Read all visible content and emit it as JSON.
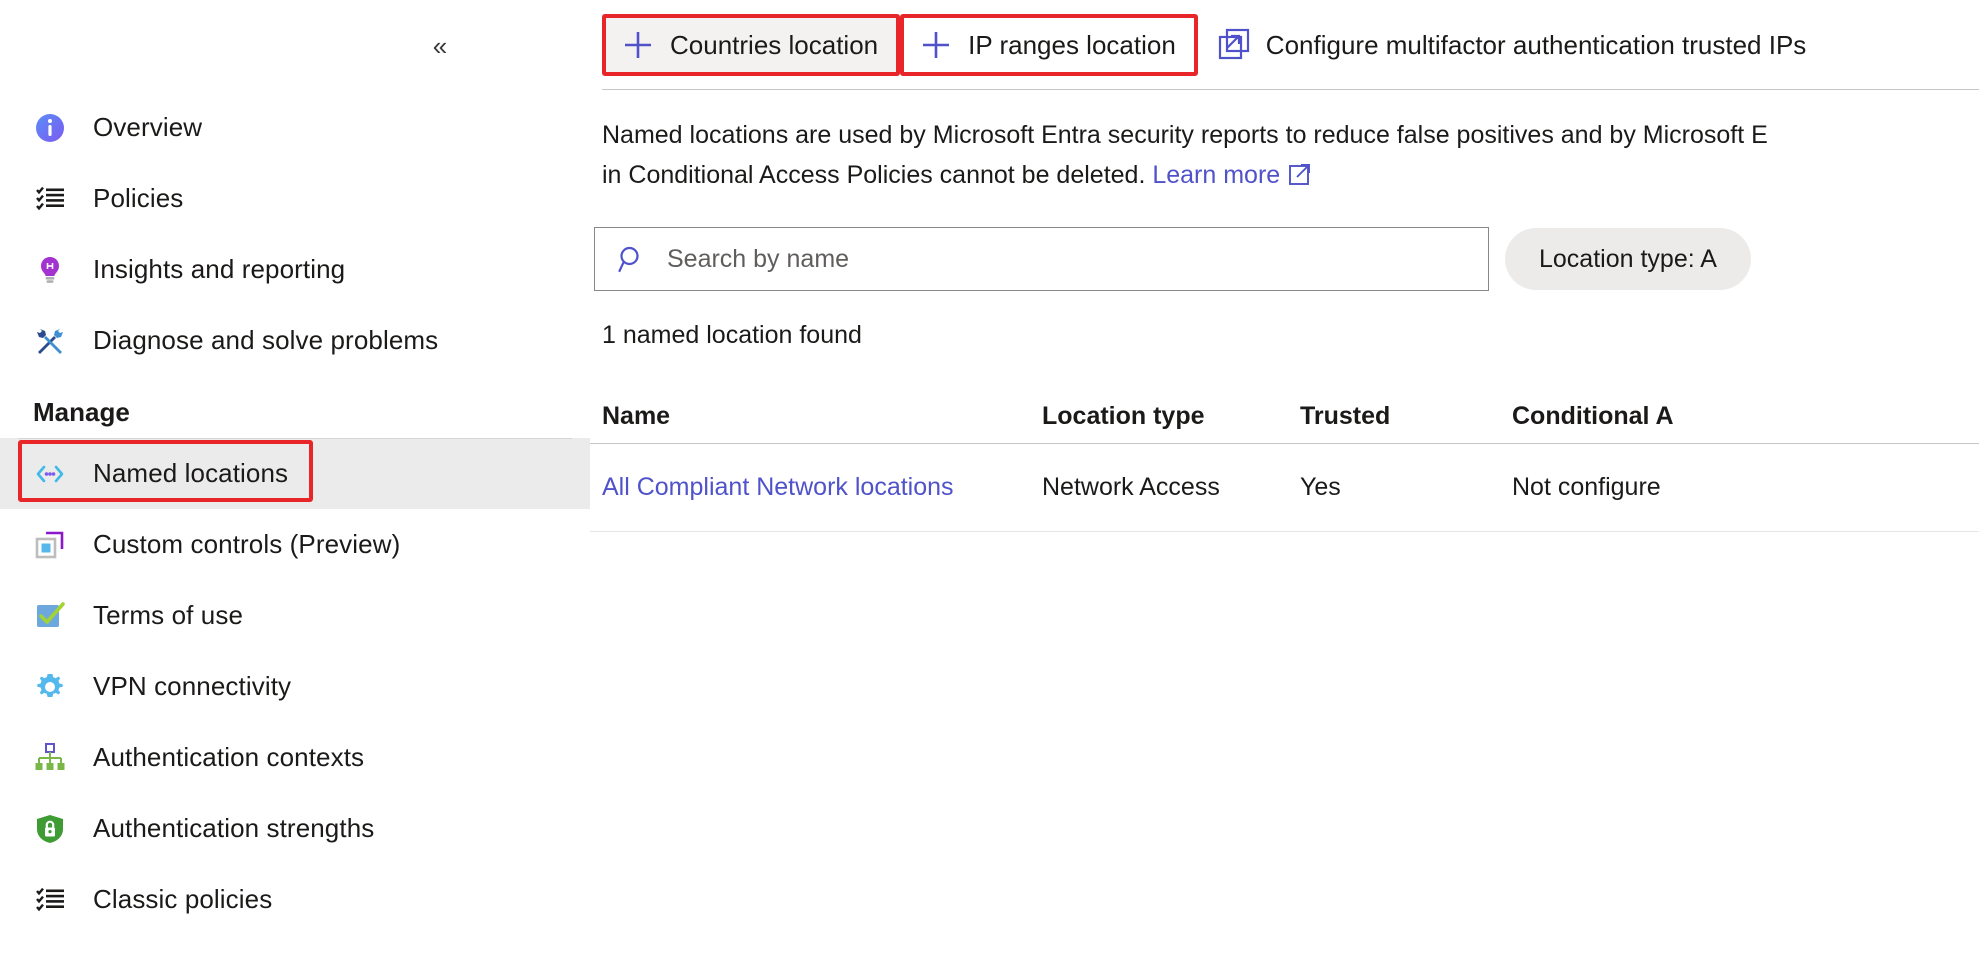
{
  "sidebar": {
    "collapse_glyph": "«",
    "collapse_label": "Collapse navigation",
    "items": [
      {
        "label": "Overview",
        "icon": "info-icon"
      },
      {
        "label": "Policies",
        "icon": "checklist-icon"
      },
      {
        "label": "Insights and reporting",
        "icon": "lightbulb-icon"
      },
      {
        "label": "Diagnose and solve problems",
        "icon": "tools-icon"
      }
    ],
    "group_label": "Manage",
    "manage_items": [
      {
        "label": "Named locations",
        "icon": "location-range-icon",
        "selected": true
      },
      {
        "label": "Custom controls (Preview)",
        "icon": "custom-controls-icon",
        "selected": false
      },
      {
        "label": "Terms of use",
        "icon": "checkbox-check-icon",
        "selected": false
      },
      {
        "label": "VPN connectivity",
        "icon": "gear-icon",
        "selected": false
      },
      {
        "label": "Authentication contexts",
        "icon": "hierarchy-icon",
        "selected": false
      },
      {
        "label": "Authentication strengths",
        "icon": "shield-lock-icon",
        "selected": false
      },
      {
        "label": "Classic policies",
        "icon": "checklist-icon",
        "selected": false
      }
    ]
  },
  "commandbar": {
    "buttons": [
      {
        "label": "Countries location",
        "icon": "plus-icon",
        "highlighted": true,
        "hovered": true
      },
      {
        "label": "IP ranges location",
        "icon": "plus-icon",
        "highlighted": true,
        "hovered": false
      },
      {
        "label": "Configure multifactor authentication trusted IPs",
        "icon": "external-link-icon",
        "highlighted": false,
        "hovered": false
      }
    ]
  },
  "description": {
    "line1": "Named locations are used by Microsoft Entra security reports to reduce false positives and by Microsoft E",
    "line2_prefix": "in Conditional Access Policies cannot be deleted. ",
    "learn_more": "Learn more"
  },
  "search": {
    "placeholder": "Search by name",
    "value": "",
    "icon": "search-icon"
  },
  "filter": {
    "pill_label": "Location type: A"
  },
  "results": {
    "count_text": "1 named location found"
  },
  "table": {
    "columns": [
      "Name",
      "Location type",
      "Trusted",
      "Conditional A"
    ],
    "rows": [
      {
        "name": "All Compliant Network locations",
        "location_type": "Network Access",
        "trusted": "Yes",
        "conditional_access": "Not configure"
      }
    ]
  },
  "colors": {
    "accent": "#4f52c9",
    "highlight": "#e8262a",
    "selected_bg": "#ebebeb",
    "hover_bg": "#f3f2f1",
    "muted": "#a19f9d"
  }
}
